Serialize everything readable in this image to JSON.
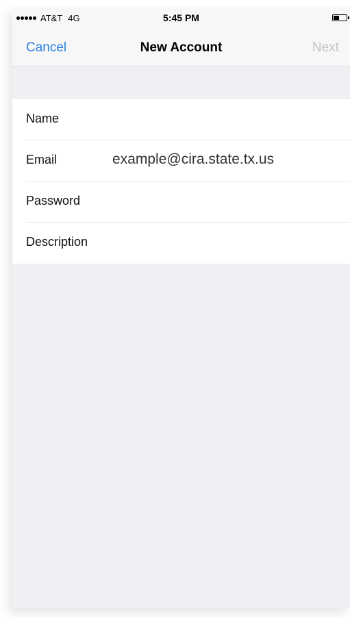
{
  "status_bar": {
    "carrier": "AT&T",
    "network": "4G",
    "time": "5:45 PM",
    "battery_level": 0.45
  },
  "nav": {
    "cancel_label": "Cancel",
    "title": "New Account",
    "next_label": "Next"
  },
  "form": {
    "name_label": "Name",
    "email_label": "Email",
    "email_value": "example@cira.state.tx.us",
    "password_label": "Password",
    "description_label": "Description"
  },
  "colors": {
    "accent": "#2a7fe0",
    "disabled": "#c4c4c8",
    "background": "#efeff4"
  }
}
